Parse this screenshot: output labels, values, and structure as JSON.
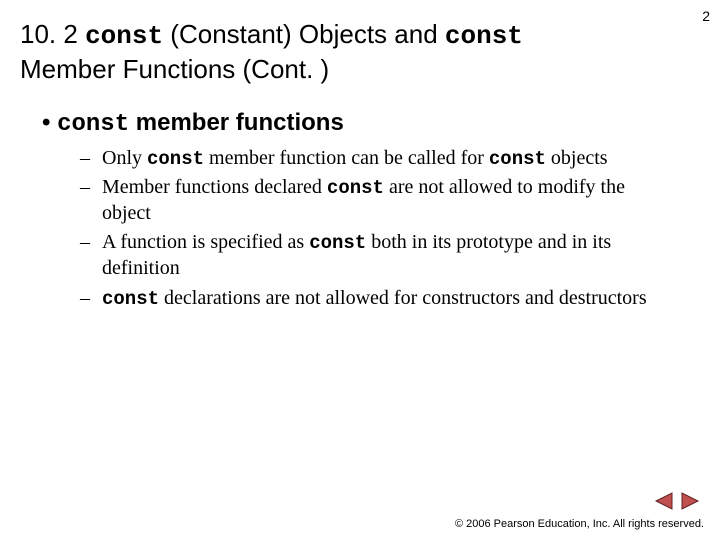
{
  "page_number": "2",
  "title": {
    "prefix": "10. 2 ",
    "kw1": "const",
    "mid1": " (Constant) Objects and ",
    "kw2": "const",
    "suffix": " Member Functions (Cont. )"
  },
  "heading": {
    "bullet": "•",
    "kw": "const",
    "rest": " member functions"
  },
  "subs": [
    {
      "dash": "–",
      "pre": "Only ",
      "kw1": "const",
      "mid": " member function can be called for ",
      "kw2": "const",
      "post": " objects"
    },
    {
      "dash": "–",
      "pre": "Member functions declared ",
      "kw1": "const",
      "mid": " are not allowed to modify the object",
      "kw2": "",
      "post": ""
    },
    {
      "dash": "–",
      "pre": "A function is specified as ",
      "kw1": "const",
      "mid": " both in its prototype and in its definition",
      "kw2": "",
      "post": ""
    },
    {
      "dash": "–",
      "pre": "",
      "kw1": "const",
      "mid": " declarations are not allowed for constructors and destructors",
      "kw2": "",
      "post": ""
    }
  ],
  "footer": "© 2006 Pearson Education, Inc. All rights reserved.",
  "nav": {
    "prev": "previous",
    "next": "next"
  },
  "colors": {
    "nav_arrow": "#c05050",
    "nav_stroke": "#602020"
  }
}
